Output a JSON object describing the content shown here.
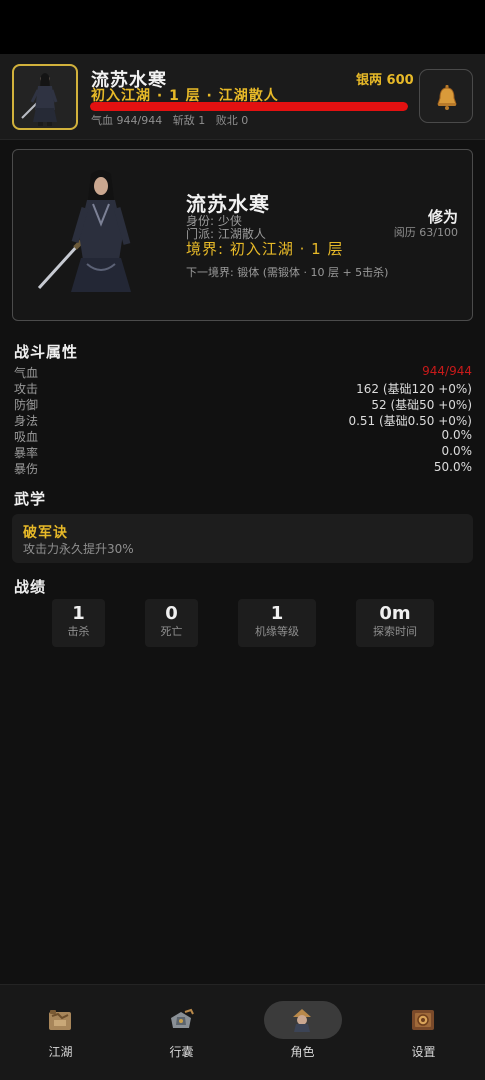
{
  "colors": {
    "accent_gold": "#e7b928",
    "hp_red": "#e31111",
    "background": "#111111",
    "panel": "#1d1d1d"
  },
  "header": {
    "name": "流苏水寒",
    "realm": "初入江湖 · 1 层 · 江湖散人",
    "silver": "银两 600",
    "hp_fraction": 1.0,
    "stats": {
      "hp": "气血 944/944",
      "kills": "斩敌 1",
      "defeats": "败北 0"
    },
    "bell_icon": "bell-icon"
  },
  "profile": {
    "name": "流苏水寒",
    "identity": "身份: 少侠",
    "sect": "门派: 江湖散人",
    "realm": "境界: 初入江湖 · 1 层",
    "next_realm": "下一境界: 锻体 (需锻体 · 10 层 + 5击杀)",
    "xiuwei_label": "修为",
    "yueli": "阅历 63/100"
  },
  "combat": {
    "title": "战斗属性",
    "rows": [
      {
        "label": "气血",
        "value": "944/944"
      },
      {
        "label": "攻击",
        "value": "162 (基础120 +0%)"
      },
      {
        "label": "防御",
        "value": "52 (基础50 +0%)"
      },
      {
        "label": "身法",
        "value": "0.51 (基础0.50 +0%)"
      },
      {
        "label": "吸血",
        "value": "0.0%"
      },
      {
        "label": "暴率",
        "value": "0.0%"
      },
      {
        "label": "暴伤",
        "value": "50.0%"
      }
    ]
  },
  "martial": {
    "title": "武学",
    "skill_name": "破军诀",
    "skill_desc": "攻击力永久提升30%"
  },
  "record": {
    "title": "战绩",
    "items": [
      {
        "value": "1",
        "label": "击杀"
      },
      {
        "value": "0",
        "label": "死亡"
      },
      {
        "value": "1",
        "label": "机缘等级"
      },
      {
        "value": "0m",
        "label": "探索时间"
      }
    ]
  },
  "nav": {
    "items": [
      {
        "label": "江湖",
        "icon": "map-icon"
      },
      {
        "label": "行囊",
        "icon": "bag-icon"
      },
      {
        "label": "角色",
        "icon": "character-icon",
        "active": true
      },
      {
        "label": "设置",
        "icon": "settings-icon"
      }
    ]
  }
}
